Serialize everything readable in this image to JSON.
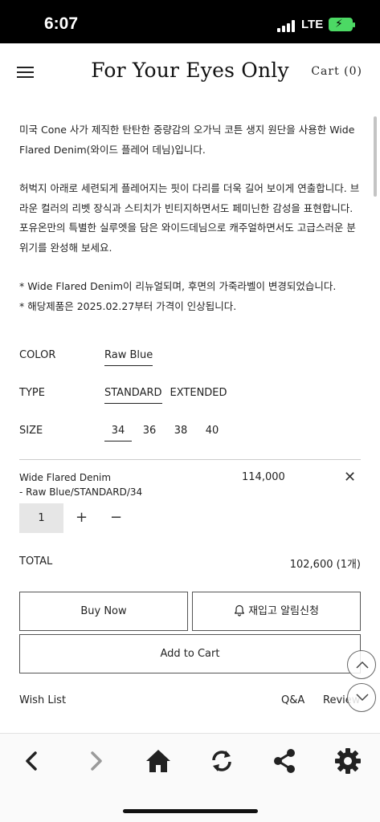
{
  "status_bar": {
    "time": "6:07",
    "network": "LTE"
  },
  "header": {
    "brand": "For Your Eyes Only",
    "cart_label": "Cart (0)"
  },
  "description": {
    "para1": "미국 Cone 사가 제직한 탄탄한 중량감의 오가닉 코튼 생지 원단을 사용한 Wide Flared Denim(와이드 플레어 데님)입니다.",
    "para2": "허벅지 아래로 세련되게 플레어지는 핏이 다리를 더욱 길어 보이게 연출합니다. 브라운 컬러의 리벳 장식과 스티치가 빈티지하면서도 페미닌한 감성을 표현합니다. 포유온만의 특별한 실루엣을 담은 와이드데님으로 캐주얼하면서도 고급스러운 분위기를 완성해 보세요.",
    "note1": "* Wide Flared Denim이 리뉴얼되며, 후면의 가죽라벨이 변경되었습니다.",
    "note2": "* 해당제품은 2025.02.27부터 가격이 인상됩니다."
  },
  "options": {
    "color": {
      "label": "COLOR",
      "values": [
        "Raw Blue"
      ],
      "selected": "Raw Blue"
    },
    "type": {
      "label": "TYPE",
      "values": [
        "STANDARD",
        "EXTENDED"
      ],
      "selected": "STANDARD"
    },
    "size": {
      "label": "SIZE",
      "values": [
        "34",
        "36",
        "38",
        "40"
      ],
      "selected": "34"
    }
  },
  "selected_item": {
    "name_line1": "Wide Flared Denim",
    "name_line2": "- Raw Blue/STANDARD/34",
    "price": "114,000",
    "quantity": "1",
    "plus": "+",
    "minus": "−",
    "remove": "✕"
  },
  "total": {
    "label": "TOTAL",
    "value": "102,600 (1개)"
  },
  "buttons": {
    "buy_now": "Buy Now",
    "restock_alert": "재입고 알림신청",
    "add_to_cart": "Add to Cart"
  },
  "links": {
    "wish_list": "Wish List",
    "qna": "Q&A",
    "review": "Review"
  },
  "toolbar": {
    "icons": [
      "back-icon",
      "forward-icon",
      "home-icon",
      "reload-icon",
      "share-icon",
      "settings-icon"
    ]
  }
}
